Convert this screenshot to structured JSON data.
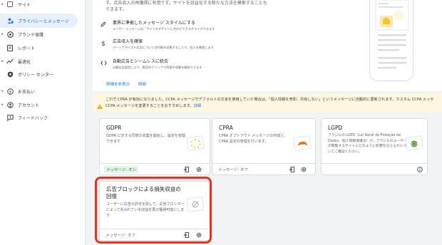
{
  "sidebar": {
    "items": [
      {
        "label": "サイト",
        "icon": "web-icon",
        "caret": true,
        "active": false
      },
      {
        "label": "プライバシーとメッセージ",
        "icon": "person-shield-icon",
        "caret": false,
        "active": true
      },
      {
        "label": "ブランド保護",
        "icon": "brand-safety-icon",
        "caret": true,
        "active": false
      },
      {
        "label": "レポート",
        "icon": "report-icon",
        "caret": false,
        "active": false
      },
      {
        "label": "最適化",
        "icon": "trending-icon",
        "caret": true,
        "active": false
      },
      {
        "label": "ポリシー センター",
        "icon": "policy-icon",
        "caret": false,
        "active": false
      },
      {
        "label": "お支払い",
        "icon": "payments-icon",
        "caret": true,
        "active": false
      },
      {
        "label": "アカウント",
        "icon": "account-icon",
        "caret": true,
        "active": false
      },
      {
        "label": "フィードバック",
        "icon": "feedback-icon",
        "caret": false,
        "active": false
      }
    ]
  },
  "intro": {
    "line1": "す。広告収入の再獲得に有用です。サイトを収益化する新たな方法を模索することも",
    "line2": "できます。"
  },
  "features": [
    {
      "icon": "pen-icon",
      "title": "業界に準拠したメッセージ スタイルにする",
      "desc": "ユーザー メッセージは、サイトのデザインに合わせてカスタマイズできます"
    },
    {
      "icon": "dollar-icon",
      "title": "広告収入を確保",
      "desc": "パーソナライズド広告についての同意を収集することで、収入を確保します"
    },
    {
      "icon": "code-icon",
      "title": "自動広告とシームレスに統合",
      "desc": "自動広告設定により、数回のクリックで同意の収集を開始できます"
    }
  ],
  "links": {
    "show_details": "詳細を非表示",
    "learn_more": "詳細"
  },
  "banner": {
    "line1": "これで CPRA が有効になりました。CCPA メッセージでデフォルトの文言を使用していた場合は、「個人情報を売却、共有しない」というメッセージに自動的に更新されます。カスタム CCPA メッセ",
    "line2": "CCPA メッセージを変更することをおすすめします。",
    "link": "詳細"
  },
  "cards": [
    {
      "title": "GDPR",
      "desc": "GDPR に対する同意の収集を開始し、設定を管理できます",
      "status": "メッセージ: オン",
      "status_on": true
    },
    {
      "title": "CPRA",
      "desc": "CPRA オプトアウト メッセージの作成と、CPRA 設定の管理を行います。",
      "status": "メッセージ: オフ",
      "status_on": false
    },
    {
      "title": "LGPD",
      "desc": "ブラジルの LGPD（Lei Geral de Proteção de Dados、個人情報保護法）が、ブラジルのユーザーが閲覧するサイトにどのように影響を与えるかについてご確認ください。",
      "status": "",
      "status_on": false
    },
    {
      "title": "広告ブロックによる損失収益の回復",
      "desc": "ユーザーに広告の許可を促して、広告ブロッカーによって失われている収益を再び獲得可能にします",
      "status": "メッセージ: オフ",
      "status_on": false
    }
  ],
  "colors": {
    "accent": "#1a73e8",
    "highlight": "#e8311e",
    "warning": "#f29900"
  }
}
